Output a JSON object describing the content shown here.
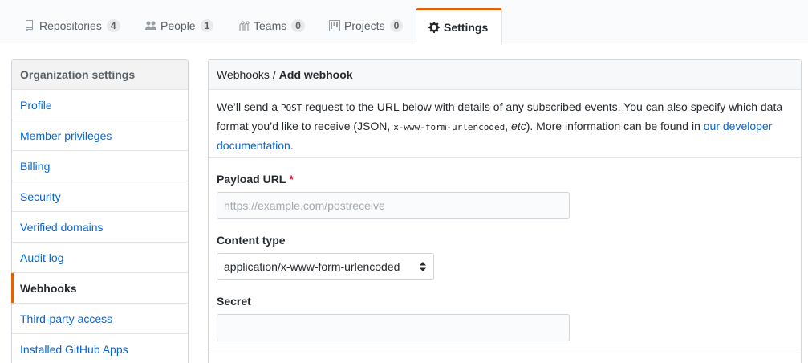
{
  "tabs": {
    "repositories": {
      "label": "Repositories",
      "count": "4",
      "icon": "repo-icon"
    },
    "people": {
      "label": "People",
      "count": "1",
      "icon": "people-icon"
    },
    "teams": {
      "label": "Teams",
      "count": "0",
      "icon": "teams-icon"
    },
    "projects": {
      "label": "Projects",
      "count": "0",
      "icon": "project-icon"
    },
    "settings": {
      "label": "Settings",
      "icon": "gear-icon"
    }
  },
  "sidebar": {
    "header": "Organization settings",
    "items": [
      {
        "label": "Profile"
      },
      {
        "label": "Member privileges"
      },
      {
        "label": "Billing"
      },
      {
        "label": "Security"
      },
      {
        "label": "Verified domains"
      },
      {
        "label": "Audit log"
      },
      {
        "label": "Webhooks",
        "selected": true
      },
      {
        "label": "Third-party access"
      },
      {
        "label": "Installed GitHub Apps"
      }
    ]
  },
  "main": {
    "breadcrumb": {
      "parent": "Webhooks",
      "separator": "/",
      "current": "Add webhook"
    },
    "intro": {
      "p1": "We’ll send a ",
      "method": "POST",
      "p2": " request to the URL below with details of any subscribed events. You can also specify which data format you’d like to receive (JSON, ",
      "format": "x-www-form-urlencoded",
      "p3": ", ",
      "etc": "etc",
      "p4": "). More information can be found in ",
      "link": "our developer documentation",
      "p5": "."
    },
    "form": {
      "payload_label": "Payload URL",
      "required_mark": "*",
      "payload_placeholder": "https://example.com/postreceive",
      "payload_value": "",
      "content_type_label": "Content type",
      "content_type_value": "application/x-www-form-urlencoded",
      "secret_label": "Secret",
      "secret_value": ""
    }
  },
  "colors": {
    "accent": "#e36209",
    "link": "#0366d6",
    "required": "#cb2431"
  }
}
